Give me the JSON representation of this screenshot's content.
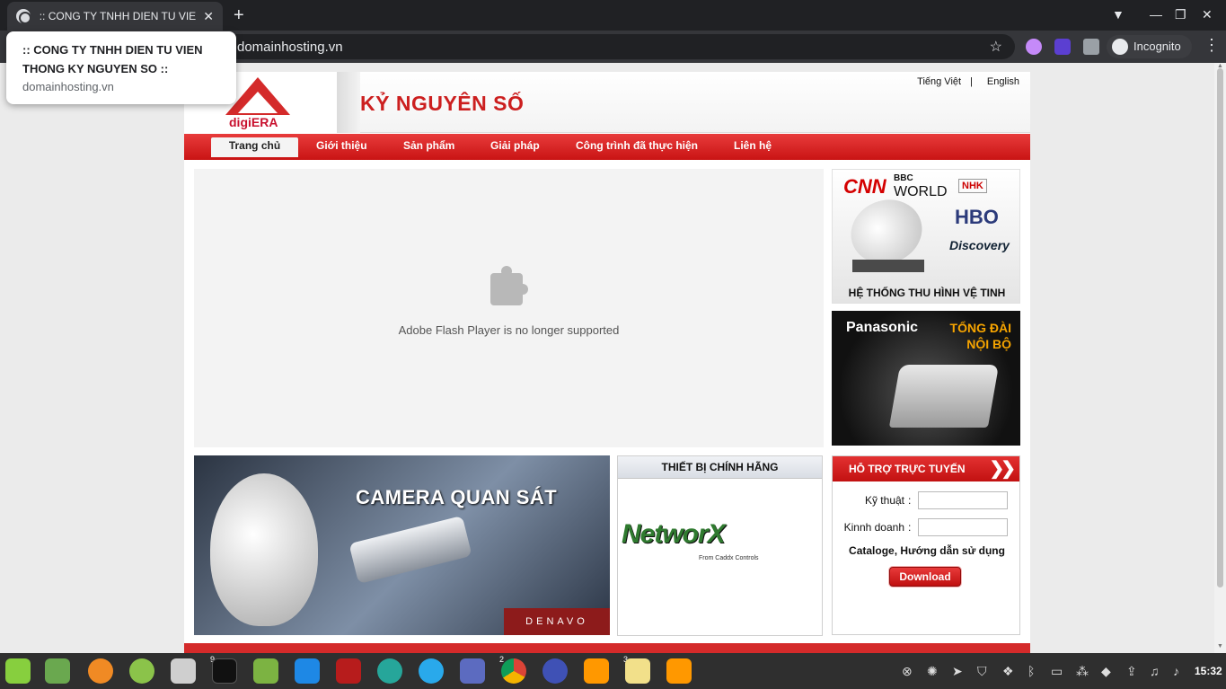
{
  "browser": {
    "tab_title": ":: CONG TY TNHH DIEN TU VIEN",
    "tab_close": "✕",
    "new_tab": "+",
    "url": "domainhosting.vn",
    "incognito_label": "Incognito",
    "hover_card": {
      "title": ":: CONG TY TNHH DIEN TU VIEN THONG KY NGUYEN SO ::",
      "url": "domainhosting.vn"
    }
  },
  "site": {
    "logo_text": "digiERA",
    "brand_name": "KỶ NGUYÊN SỐ",
    "languages": [
      "Tiếng Việt",
      "English"
    ],
    "nav": [
      "Trang chủ",
      "Giới thiệu",
      "Sản phẩm",
      "Giải pháp",
      "Công trình đã thực hiện",
      "Liên hệ"
    ],
    "flash_message": "Adobe Flash Player is no longer supported",
    "ad_satellite": {
      "brands": [
        "CNN",
        "BBC",
        "WORLD",
        "NHK",
        "HBO",
        "Discovery"
      ],
      "caption": "HỆ THỐNG THU HÌNH VỆ TINH"
    },
    "ad_pbx": {
      "brand": "Panasonic",
      "title_line1": "TỔNG ĐÀI",
      "title_line2": "NỘI BỘ"
    },
    "camera_banner": {
      "title": "CAMERA QUAN SÁT",
      "brand": "DENAVO"
    },
    "products_panel": {
      "heading": "THIẾT BỊ CHÍNH HÃNG",
      "logo_text": "NetworX",
      "logo_sub": "From Caddx Controls"
    },
    "support_panel": {
      "heading": "HỖ TRỢ TRỰC TUYẾN",
      "rows": [
        {
          "label": "Kỹ thuật",
          "colon": ":"
        },
        {
          "label": "Kinnh doanh",
          "colon": ":"
        }
      ],
      "catalogue": "Cataloge, Hướng dẫn sử dụng",
      "download": "Download"
    }
  },
  "taskbar": {
    "badges": {
      "terminal": "9",
      "chrome": "2",
      "sublime": "3"
    },
    "clock": "15:32"
  },
  "colors": {
    "brand_red": "#d42a2a",
    "nav_red": "#c91414",
    "chrome_dark": "#202124",
    "chrome_toolbar": "#35363a"
  }
}
